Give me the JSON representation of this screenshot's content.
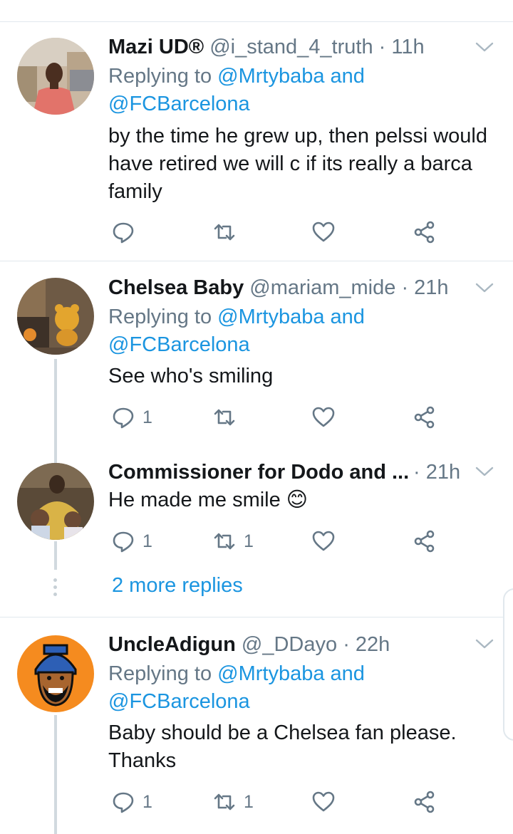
{
  "tweets": [
    {
      "name": "Mazi UD®",
      "handle": "@i_stand_4_truth",
      "dot": "·",
      "time": "11h",
      "reply_prefix": "Replying to ",
      "reply_mention1": "@Mrtybaba",
      "reply_and": " and",
      "reply_mention2": "@FCBarcelona",
      "text": "by the time he grew up, then pelssi would have retired we will c if its really a barca family",
      "reply_count": "",
      "retweet_count": "",
      "like_count": ""
    },
    {
      "name": "Chelsea Baby",
      "handle": "@mariam_mide",
      "dot": "·",
      "time": "21h",
      "reply_prefix": "Replying to ",
      "reply_mention1": "@Mrtybaba",
      "reply_and": " and",
      "reply_mention2": "@FCBarcelona",
      "text": "See who's smiling",
      "reply_count": "1",
      "retweet_count": "",
      "like_count": ""
    },
    {
      "name": "Commissioner for Dodo and ...",
      "handle": "",
      "dot": "·",
      "time": "21h",
      "text": "He made me smile 😊",
      "reply_count": "1",
      "retweet_count": "1",
      "like_count": ""
    },
    {
      "name": "UncleAdigun",
      "handle": "@_DDayo",
      "dot": "·",
      "time": "22h",
      "reply_prefix": "Replying to ",
      "reply_mention1": "@Mrtybaba",
      "reply_and": " and",
      "reply_mention2": "@FCBarcelona",
      "text": "Baby should be a Chelsea fan please. Thanks",
      "reply_count": "1",
      "retweet_count": "1",
      "like_count": ""
    }
  ],
  "more_replies": "2 more replies",
  "icons": {
    "reply": "reply-icon",
    "retweet": "retweet-icon",
    "like": "heart-icon",
    "share": "share-icon",
    "more": "chevron-down-icon"
  },
  "colors": {
    "link": "#1b95e0",
    "secondary": "#657786",
    "divider": "#e1e8ed",
    "avatar_orange": "#f58b1f"
  }
}
